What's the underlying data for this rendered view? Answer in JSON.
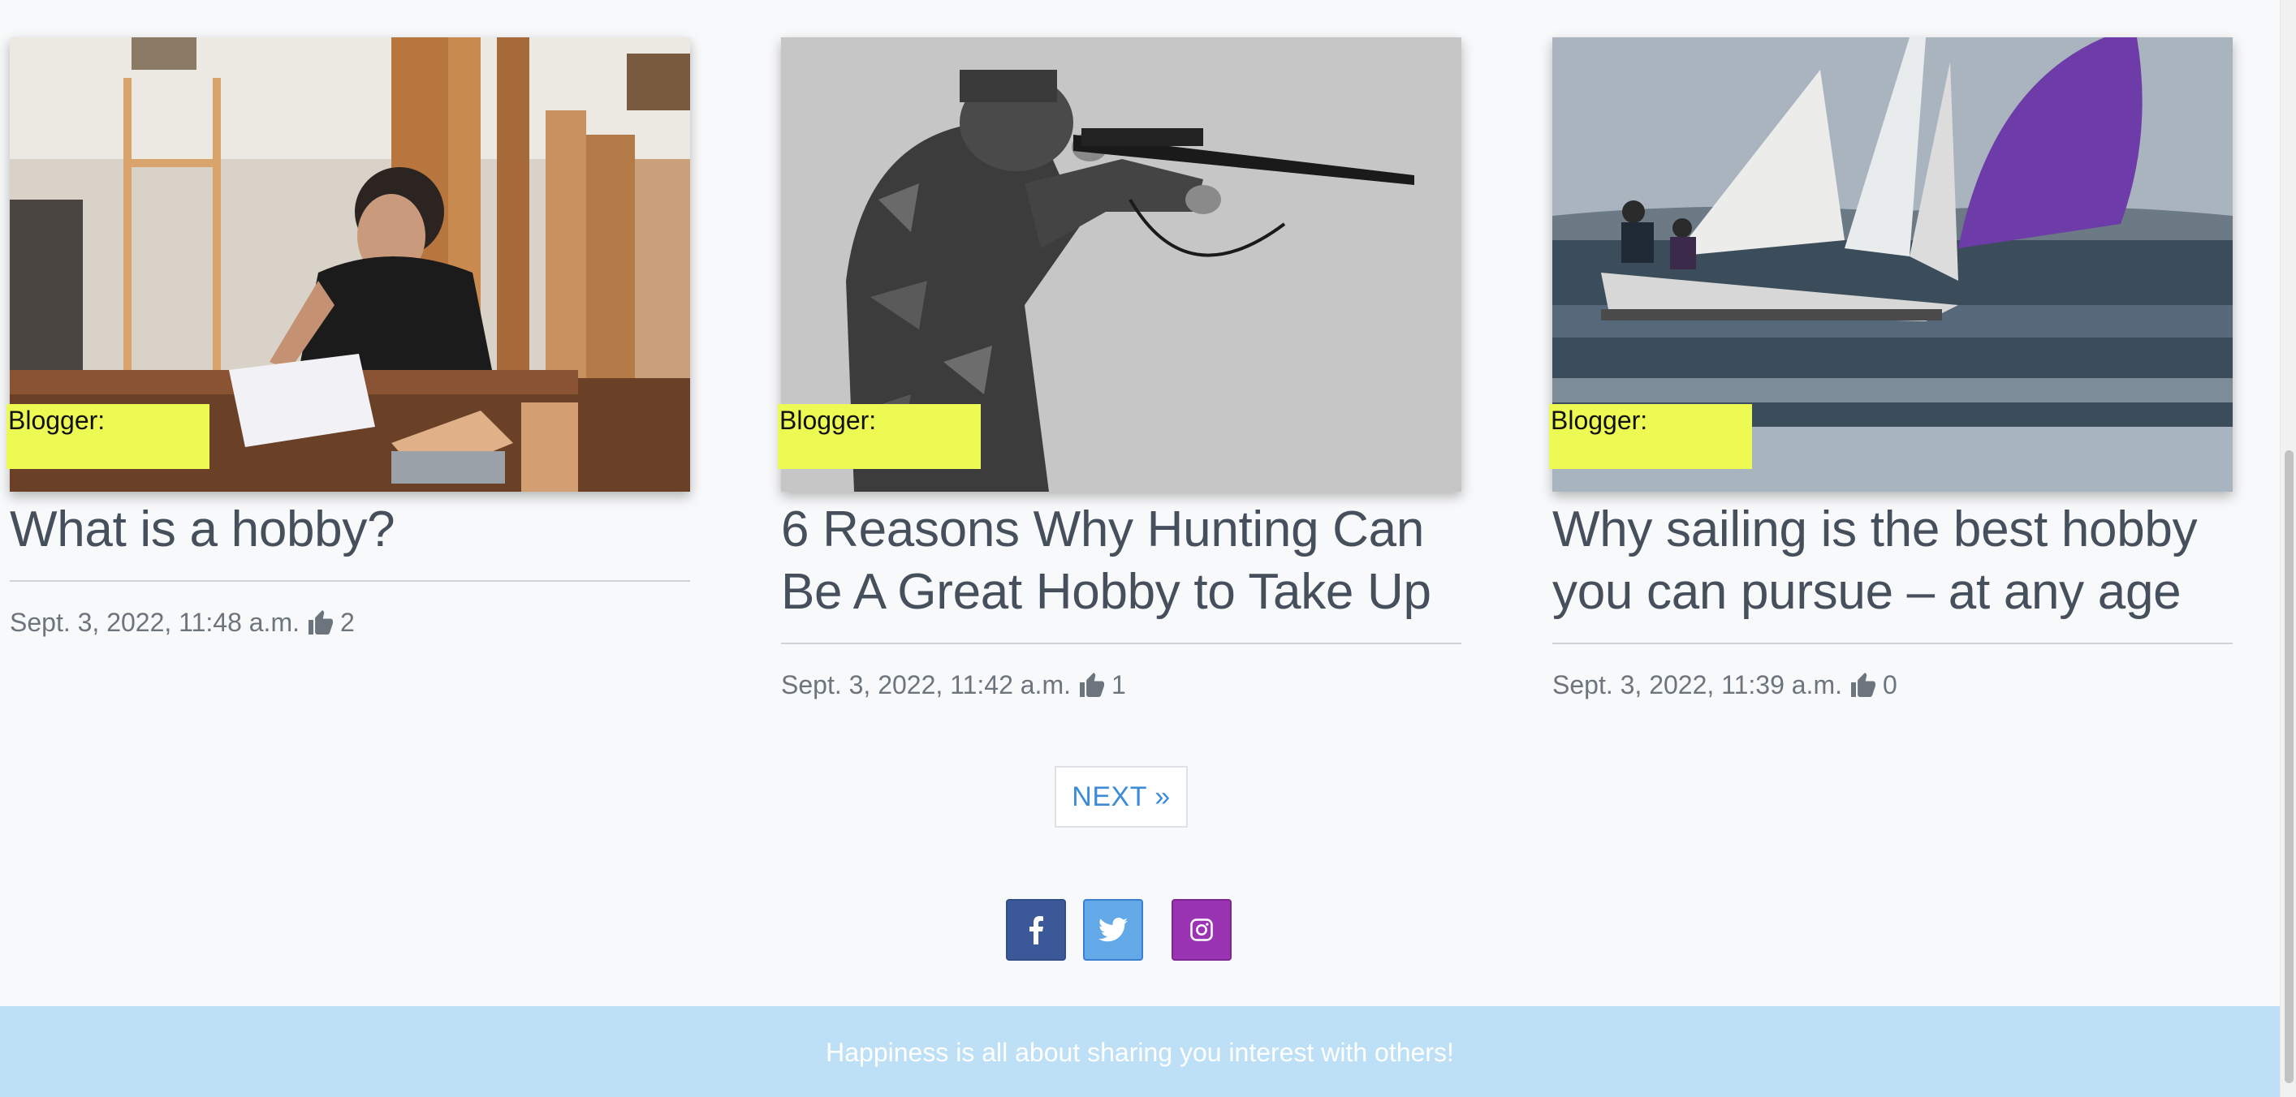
{
  "cards": [
    {
      "blogger_label": "Blogger:",
      "title": "What is a hobby?",
      "date": "Sept. 3, 2022, 11:48 a.m.",
      "likes": "2",
      "image": "woodworking-workshop-photo"
    },
    {
      "blogger_label": "Blogger:",
      "title": "6 Reasons Why Hunting Can Be A Great Hobby to Take Up",
      "date": "Sept. 3, 2022, 11:42 a.m.",
      "likes": "1",
      "image": "hunter-with-shotgun-photo"
    },
    {
      "blogger_label": "Blogger:",
      "title": "Why sailing is the best hobby you can pursue – at any age",
      "date": "Sept. 3, 2022, 11:39 a.m.",
      "likes": "0",
      "image": "sailboat-racing-photo"
    }
  ],
  "pagination": {
    "next_label": "NEXT »"
  },
  "social": {
    "facebook_icon": "facebook-icon",
    "twitter_icon": "twitter-icon",
    "instagram_icon": "instagram-icon"
  },
  "footer": {
    "text": "Happiness is all about sharing you interest with others!"
  },
  "colors": {
    "blogger_tag": "#ecfa53",
    "title_text": "#464f5c",
    "meta_text": "#6c757d",
    "next_link": "#3d8bd6",
    "facebook": "#3b5998",
    "twitter": "#63a9e8",
    "instagram": "#9b34b3",
    "footer_bg": "#bde0f7"
  }
}
